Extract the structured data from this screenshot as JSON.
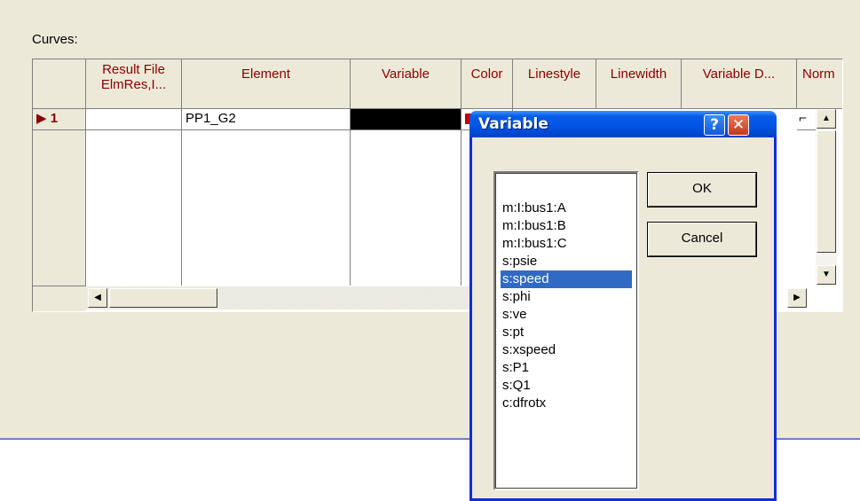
{
  "curves_label": "Curves:",
  "columns": [
    {
      "label": "Result File\nElmRes,I..."
    },
    {
      "label": "Element"
    },
    {
      "label": "Variable"
    },
    {
      "label": "Color"
    },
    {
      "label": "Linestyle"
    },
    {
      "label": "Linewidth"
    },
    {
      "label": "Variable D..."
    },
    {
      "label": "Norm"
    }
  ],
  "rows": [
    {
      "index": "▶ 1",
      "result_file": "",
      "element": "PP1_G2",
      "variable": ""
    }
  ],
  "dialog": {
    "title": "Variable",
    "help_label": "?",
    "close_label": "✕",
    "ok_label": "OK",
    "cancel_label": "Cancel",
    "items": [
      "m:I:bus1:A",
      "m:I:bus1:B",
      "m:I:bus1:C",
      "s:psie",
      "s:speed",
      "s:phi",
      "s:ve",
      "s:pt",
      "s:xspeed",
      "s:P1",
      "s:Q1",
      "c:dfrotx"
    ],
    "selected": "s:speed"
  },
  "colors": {
    "header_text": "#8b0000",
    "selection": "#316ac5",
    "title_bar": "#0054e3"
  }
}
